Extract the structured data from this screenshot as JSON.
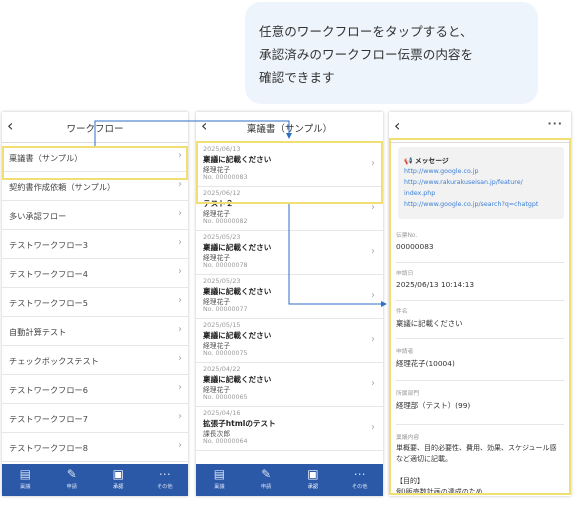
{
  "callout": {
    "lines": [
      "任意のワークフローをタップすると、",
      "承認済みのワークフロー伝票の内容を",
      "確認できます"
    ]
  },
  "screen1": {
    "title": "ワークフロー",
    "items": [
      "稟議書（サンプル）",
      "契約書作成依頼（サンプル）",
      "多い承認フロー",
      "テストワークフロー3",
      "テストワークフロー4",
      "テストワークフロー5",
      "自動計算テスト",
      "チェックボックステスト",
      "テストワークフロー6",
      "テストワークフロー7",
      "テストワークフロー8"
    ]
  },
  "screen2": {
    "title": "稟議書（サンプル）",
    "items": [
      {
        "date": "2025/06/13",
        "title": "稟議に記載ください",
        "name": "経理花子",
        "no": "No. 00000083"
      },
      {
        "date": "2025/06/12",
        "title": "テスト２",
        "name": "経理花子",
        "no": "No. 00000082"
      },
      {
        "date": "2025/05/23",
        "title": "稟議に記載ください",
        "name": "経理花子",
        "no": "No. 00000078"
      },
      {
        "date": "2025/05/23",
        "title": "稟議に記載ください",
        "name": "経理花子",
        "no": "No. 00000077"
      },
      {
        "date": "2025/05/15",
        "title": "稟議に記載ください",
        "name": "経理花子",
        "no": "No. 00000075"
      },
      {
        "date": "2025/04/22",
        "title": "稟議に記載ください",
        "name": "経理花子",
        "no": "No. 00000065"
      },
      {
        "date": "2025/04/16",
        "title": "拡張子htmlのテスト",
        "name": "課長次郎",
        "no": "No. 00000064"
      }
    ]
  },
  "screen3": {
    "message": {
      "title": "メッセージ",
      "links": [
        "http://www.google.co.jp",
        "http://www.rakurakuseisan.jp/feature/",
        "index.php",
        "http://www.google.co.jp/search?q=chatgpt"
      ]
    },
    "fields": [
      {
        "label": "伝票No.",
        "value": "00000083"
      },
      {
        "label": "申請日",
        "value": "2025/06/13 10:14:13"
      },
      {
        "label": "件名",
        "value": "稟議に記載ください"
      },
      {
        "label": "申請者",
        "value": "経理花子(10004)"
      },
      {
        "label": "所属部門",
        "value": "経理部（テスト）(99)"
      }
    ],
    "content": {
      "label": "稟議内容",
      "lines": [
        "単概要、目的必要性、費用、効果、スケジュール感",
        "など適切に記載。",
        "",
        "【目的】",
        "例)販売数計画の達成のため"
      ]
    }
  },
  "tabs": [
    {
      "label": "稟議",
      "icon": "document-icon"
    },
    {
      "label": "申請",
      "icon": "edit-icon"
    },
    {
      "label": "承認",
      "icon": "approve-icon"
    },
    {
      "label": "その他",
      "icon": "more-icon"
    }
  ],
  "colors": {
    "tabbar": "#2b59a8",
    "highlight": "#f1df74",
    "connector": "#2e6fc4",
    "link": "#3b7fd6",
    "callout_bg": "#eef4fb"
  }
}
